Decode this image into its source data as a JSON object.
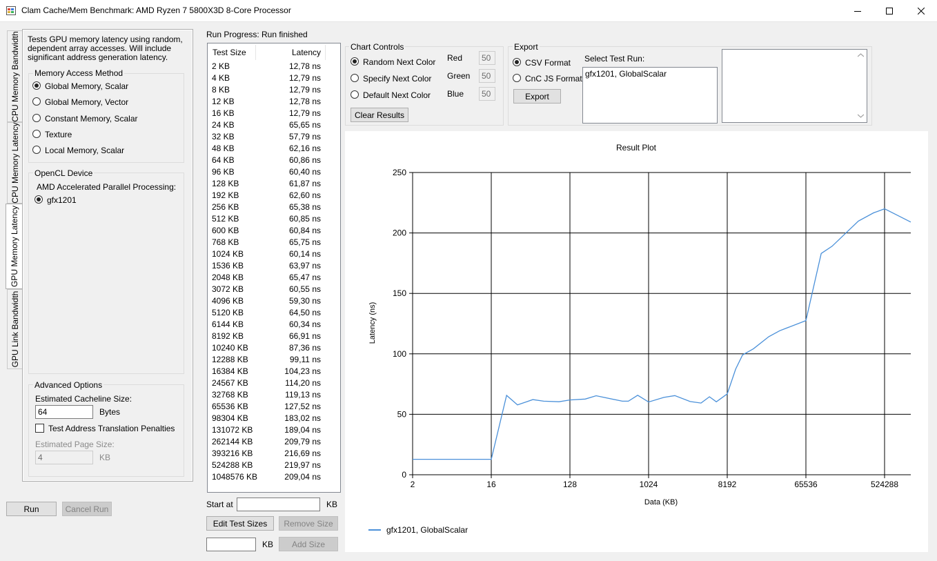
{
  "window": {
    "title": "Clam Cache/Mem Benchmark: AMD Ryzen 7 5800X3D 8-Core Processor",
    "icons": {
      "minimize": "minimize-icon",
      "maximize": "maximize-icon",
      "close": "close-icon"
    }
  },
  "tabs": [
    "CPU Memory Bandwidth",
    "CPU Memory Latency",
    "GPU Memory Latency",
    "GPU Link Bandwidth"
  ],
  "active_tab": "GPU Memory Latency",
  "description": "Tests GPU memory latency using random, dependent array accesses. Will include significant address generation latency.",
  "memory_access": {
    "title": "Memory Access Method",
    "options": [
      "Global Memory, Scalar",
      "Global Memory, Vector",
      "Constant Memory, Scalar",
      "Texture",
      "Local Memory, Scalar"
    ],
    "selected": 0
  },
  "opencl": {
    "title": "OpenCL Device",
    "platform": "AMD Accelerated Parallel Processing:",
    "device": "gfx1201"
  },
  "advanced": {
    "title": "Advanced Options",
    "cacheline_label": "Estimated Cacheline Size:",
    "cacheline_value": "64",
    "cacheline_unit": "Bytes",
    "tlb_label": "Test Address Translation Penalties",
    "page_label": "Estimated Page Size:",
    "page_value": "4",
    "page_unit": "KB"
  },
  "buttons": {
    "run": "Run",
    "cancel": "Cancel Run"
  },
  "progress": {
    "label": "Run Progress:",
    "status": "Run finished"
  },
  "results": {
    "headers": [
      "Test Size",
      "Latency"
    ],
    "rows": [
      [
        "2 KB",
        "12,78 ns"
      ],
      [
        "4 KB",
        "12,79 ns"
      ],
      [
        "8 KB",
        "12,79 ns"
      ],
      [
        "12 KB",
        "12,78 ns"
      ],
      [
        "16 KB",
        "12,79 ns"
      ],
      [
        "24 KB",
        "65,65 ns"
      ],
      [
        "32 KB",
        "57,79 ns"
      ],
      [
        "48 KB",
        "62,16 ns"
      ],
      [
        "64 KB",
        "60,86 ns"
      ],
      [
        "96 KB",
        "60,40 ns"
      ],
      [
        "128 KB",
        "61,87 ns"
      ],
      [
        "192 KB",
        "62,60 ns"
      ],
      [
        "256 KB",
        "65,38 ns"
      ],
      [
        "512 KB",
        "60,85 ns"
      ],
      [
        "600 KB",
        "60,84 ns"
      ],
      [
        "768 KB",
        "65,75 ns"
      ],
      [
        "1024 KB",
        "60,14 ns"
      ],
      [
        "1536 KB",
        "63,97 ns"
      ],
      [
        "2048 KB",
        "65,47 ns"
      ],
      [
        "3072 KB",
        "60,55 ns"
      ],
      [
        "4096 KB",
        "59,30 ns"
      ],
      [
        "5120 KB",
        "64,50 ns"
      ],
      [
        "6144 KB",
        "60,34 ns"
      ],
      [
        "8192 KB",
        "66,91 ns"
      ],
      [
        "10240 KB",
        "87,36 ns"
      ],
      [
        "12288 KB",
        "99,11 ns"
      ],
      [
        "16384 KB",
        "104,23 ns"
      ],
      [
        "24567 KB",
        "114,20 ns"
      ],
      [
        "32768 KB",
        "119,13 ns"
      ],
      [
        "65536 KB",
        "127,52 ns"
      ],
      [
        "98304 KB",
        "183,02 ns"
      ],
      [
        "131072 KB",
        "189,04 ns"
      ],
      [
        "262144 KB",
        "209,79 ns"
      ],
      [
        "393216 KB",
        "216,69 ns"
      ],
      [
        "524288 KB",
        "219,97 ns"
      ],
      [
        "1048576 KB",
        "209,04 ns"
      ]
    ]
  },
  "sizes": {
    "start_label": "Start at",
    "start_unit": "KB",
    "edit_label": "Edit Test Sizes",
    "remove_label": "Remove Size",
    "add_unit": "KB",
    "add_label": "Add Size"
  },
  "chart_controls": {
    "title": "Chart Controls",
    "options": [
      "Random Next Color",
      "Specify Next Color",
      "Default Next Color"
    ],
    "selected": 0,
    "red_label": "Red",
    "red_value": "50",
    "green_label": "Green",
    "green_value": "50",
    "blue_label": "Blue",
    "blue_value": "50",
    "clear_label": "Clear Results"
  },
  "export": {
    "title": "Export",
    "formats": [
      "CSV Format",
      "CnC JS Format"
    ],
    "selected": 0,
    "button": "Export",
    "select_label": "Select Test Run:",
    "runs": [
      "gfx1201, GlobalScalar"
    ]
  },
  "chart_data": {
    "type": "line",
    "title": "Result Plot",
    "xlabel": "Data (KB)",
    "ylabel": "Latency (ns)",
    "xscale": "log2",
    "xlim": [
      2,
      1048576
    ],
    "ylim": [
      0,
      250
    ],
    "xticks": [
      "2",
      "16",
      "128",
      "1024",
      "8192",
      "65536",
      "524288"
    ],
    "yticks": [
      "0",
      "50",
      "100",
      "150",
      "200",
      "250"
    ],
    "grid": true,
    "legend_position": "bottom-left",
    "series": [
      {
        "name": "gfx1201, GlobalScalar",
        "color": "#4a90d9",
        "x": [
          2,
          4,
          8,
          12,
          16,
          24,
          32,
          48,
          64,
          96,
          128,
          192,
          256,
          512,
          600,
          768,
          1024,
          1536,
          2048,
          3072,
          4096,
          5120,
          6144,
          8192,
          10240,
          12288,
          16384,
          24567,
          32768,
          65536,
          98304,
          131072,
          262144,
          393216,
          524288,
          1048576
        ],
        "y": [
          12.78,
          12.79,
          12.79,
          12.78,
          12.79,
          65.65,
          57.79,
          62.16,
          60.86,
          60.4,
          61.87,
          62.6,
          65.38,
          60.85,
          60.84,
          65.75,
          60.14,
          63.97,
          65.47,
          60.55,
          59.3,
          64.5,
          60.34,
          66.91,
          87.36,
          99.11,
          104.23,
          114.2,
          119.13,
          127.52,
          183.02,
          189.04,
          209.79,
          216.69,
          219.97,
          209.04
        ]
      }
    ]
  }
}
